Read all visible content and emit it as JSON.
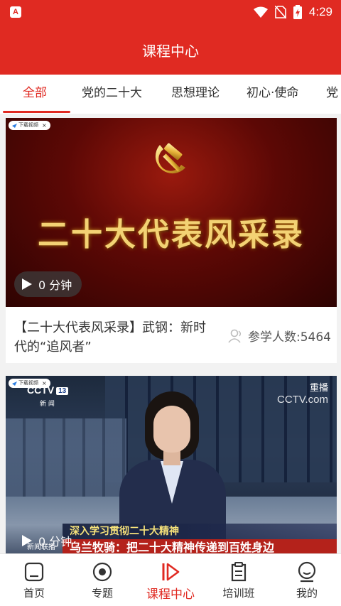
{
  "status_bar": {
    "time": "4:29",
    "app_icon_letter": "A"
  },
  "header": {
    "title": "课程中心"
  },
  "tabs": [
    {
      "label": "全部",
      "active": true
    },
    {
      "label": "党的二十大"
    },
    {
      "label": "思想理论"
    },
    {
      "label": "初心·使命"
    },
    {
      "label": "党"
    }
  ],
  "courses": [
    {
      "source_badge": "下载视频",
      "banner_text": "二十大代表风采录",
      "duration": "0 分钟",
      "title": "【二十大代表风采录】武钢：新时代的“追风者”",
      "learners": "参学人数:5464"
    },
    {
      "source_badge": "下载视频",
      "duration": "0 分钟",
      "channel": "CCTV",
      "channel_number": "13",
      "channel_sub": "新 闻",
      "replay": "重播",
      "site": "CCTV.com",
      "news_tag": "新闻联播",
      "strip_top": "深入学习贯彻二十大精神",
      "strip_bottom": "乌兰牧骑：把二十大精神传递到百姓身边"
    }
  ],
  "bottom_nav": [
    {
      "label": "首页",
      "icon": "home-icon"
    },
    {
      "label": "专题",
      "icon": "topic-icon"
    },
    {
      "label": "课程中心",
      "icon": "course-play-icon",
      "active": true
    },
    {
      "label": "培训班",
      "icon": "training-icon"
    },
    {
      "label": "我的",
      "icon": "profile-icon"
    }
  ],
  "colors": {
    "brand": "#e02a22",
    "text": "#333333",
    "muted": "#555555"
  }
}
